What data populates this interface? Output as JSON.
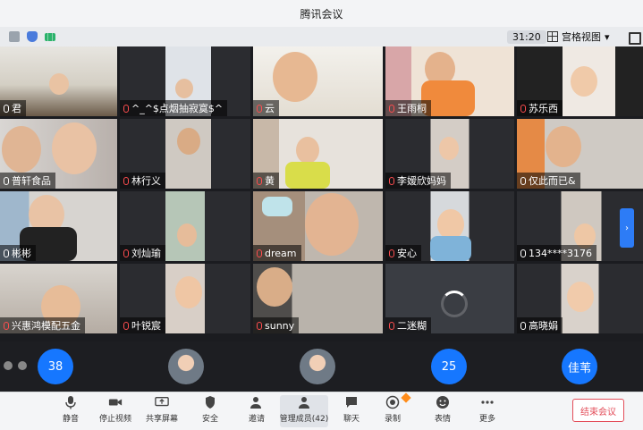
{
  "window": {
    "title": "腾讯会议"
  },
  "status": {
    "time": "31:20",
    "view_mode": "宫格视图",
    "view_caret": "▾"
  },
  "tiles": [
    {
      "name": "君"
    },
    {
      "name": "^_^$点烟抽寂寞$^"
    },
    {
      "name": "云"
    },
    {
      "name": "王雨桐"
    },
    {
      "name": "苏乐西"
    },
    {
      "name": "普轩食品"
    },
    {
      "name": "林行义"
    },
    {
      "name": "黄"
    },
    {
      "name": "李嫒欣妈妈"
    },
    {
      "name": "仅此而已&"
    },
    {
      "name": "彬彬"
    },
    {
      "name": "刘灿瑜"
    },
    {
      "name": "dream"
    },
    {
      "name": "安心"
    },
    {
      "name": "134****3176"
    },
    {
      "name": "兴惠鸿模配五金"
    },
    {
      "name": "叶锐宸"
    },
    {
      "name": "sunny"
    },
    {
      "name": "二迷糊"
    },
    {
      "name": "高晓娟"
    }
  ],
  "bottom_avatars": [
    {
      "label": "38"
    },
    {
      "label": ""
    },
    {
      "label": ""
    },
    {
      "label": "25"
    },
    {
      "label": "佳苇"
    }
  ],
  "pager": {
    "arrow": "›"
  },
  "toolbar": {
    "mute": "静音",
    "stop_video": "停止视频",
    "share_screen": "共享屏幕",
    "security": "安全",
    "invite": "邀请",
    "manage_members": "管理成员(42)",
    "chat": "聊天",
    "record": "录制",
    "reactions": "表情",
    "more": "更多",
    "end_meeting": "结束会议"
  },
  "colors": {
    "accent": "#1677ff",
    "danger": "#e34d59",
    "toolbar_bg": "#f4f5f7"
  }
}
